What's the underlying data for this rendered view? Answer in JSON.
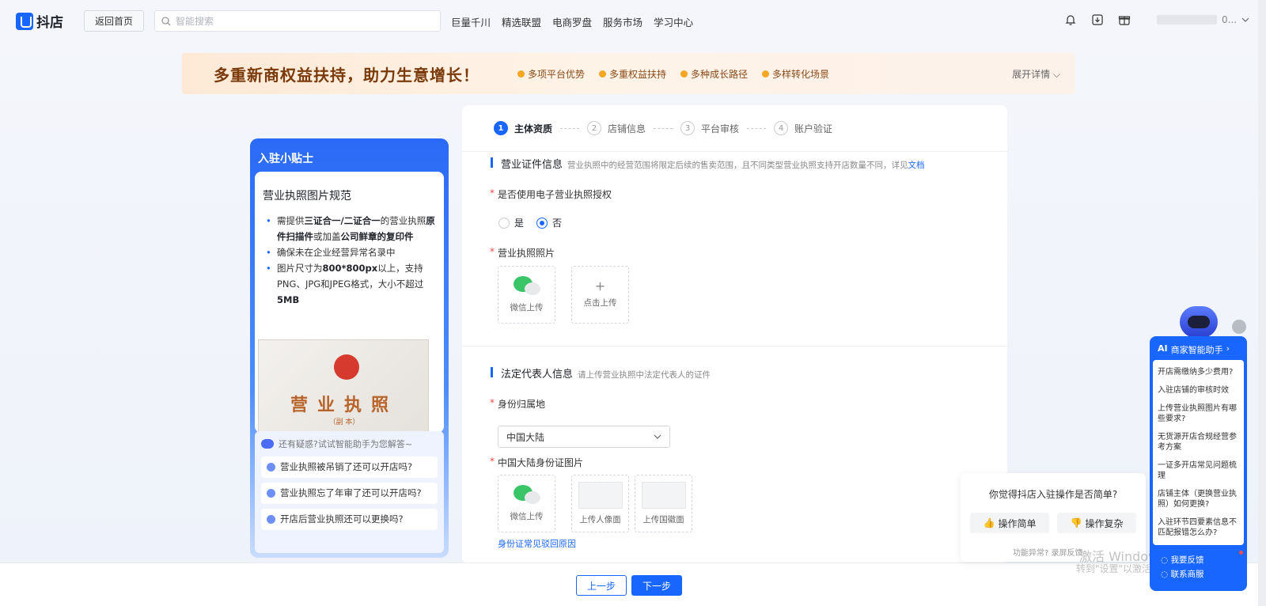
{
  "header": {
    "logo_text": "抖店",
    "back_label": "返回首页",
    "search_placeholder": "智能搜索",
    "nav": [
      "巨量千川",
      "精选联盟",
      "电商罗盘",
      "服务市场",
      "学习中心"
    ],
    "user_name_suffix": "0...",
    "icons": [
      "bell-icon",
      "download-icon",
      "gift-icon"
    ]
  },
  "banner": {
    "title": "多重新商权益扶持，助力生意增长！",
    "features": [
      "多项平台优势",
      "多重权益扶持",
      "多种成长路径",
      "多样转化场景"
    ],
    "more": "展开详情"
  },
  "tips": {
    "title": "入驻小贴士",
    "card_title": "营业执照图片规范",
    "rules": [
      [
        "需提供",
        "三证合一/二证合一",
        "的营业执照",
        "原件扫描件",
        "或加盖",
        "公司鲜章的复印件",
        ""
      ],
      [
        "确保未在企业经营异常名录中"
      ],
      [
        "图片尺寸为",
        "800*800px",
        "以上，支持PNG、JPG和JPEG格式，大小不超过",
        "5MB"
      ]
    ],
    "license_title": "营业执照",
    "license_sub": "（副 本）",
    "ask_head": "还有疑惑?试试智能助手为您解答~",
    "ask_items": [
      "营业执照被吊销了还可以开店吗?",
      "营业执照忘了年审了还可以开店吗?",
      "开店后营业执照还可以更换吗?"
    ]
  },
  "form": {
    "steps": [
      {
        "num": "1",
        "label": "主体资质",
        "active": true
      },
      {
        "num": "2",
        "label": "店铺信息",
        "active": false
      },
      {
        "num": "3",
        "label": "平台审核",
        "active": false
      },
      {
        "num": "4",
        "label": "账户验证",
        "active": false
      }
    ],
    "section1_title": "营业证件信息",
    "section1_desc": "营业执照中的经营范围将限定后续的售卖范围，且不同类型营业执照支持开店数量不同，详见",
    "section1_link": "文档",
    "q_electronic": "是否使用电子营业执照授权",
    "radio_yes": "是",
    "radio_no": "否",
    "radio_selected": "否",
    "license_photo_label": "营业执照照片",
    "upload_wechat": "微信上传",
    "upload_click": "点击上传",
    "section2_title": "法定代表人信息",
    "section2_desc": "请上传营业执照中法定代表人的证件",
    "id_region_label": "身份归属地",
    "id_region_value": "中国大陆",
    "id_photo_label": "中国大陆身份证图片",
    "id_wechat": "微信上传",
    "id_front": "上传人像面",
    "id_back": "上传国徽面",
    "id_link": "身份证常见驳回原因"
  },
  "footer": {
    "prev": "上一步",
    "next": "下一步"
  },
  "feedback": {
    "question": "你觉得抖店入驻操作是否简单?",
    "simple": "操作简单",
    "complex": "操作复杂",
    "note": "功能异常? 录屏反馈"
  },
  "watermark": {
    "line1": "激活 Windows",
    "line2": "转到\"设置\"以激活 Windows。"
  },
  "assistant": {
    "title": "商家智能助手",
    "badge": "AI",
    "questions": [
      "开店需缴纳多少费用?",
      "入驻店铺的审核时效",
      "上传营业执照图片有哪些要求?",
      "无货源开店合规经营参考方案",
      "一证多开店常见问题梳理",
      "店铺主体（更换营业执照）如何更换?",
      "入驻环节四要素信息不匹配报错怎么办?"
    ],
    "feedback": "我要反馈",
    "contact": "联系商服"
  }
}
